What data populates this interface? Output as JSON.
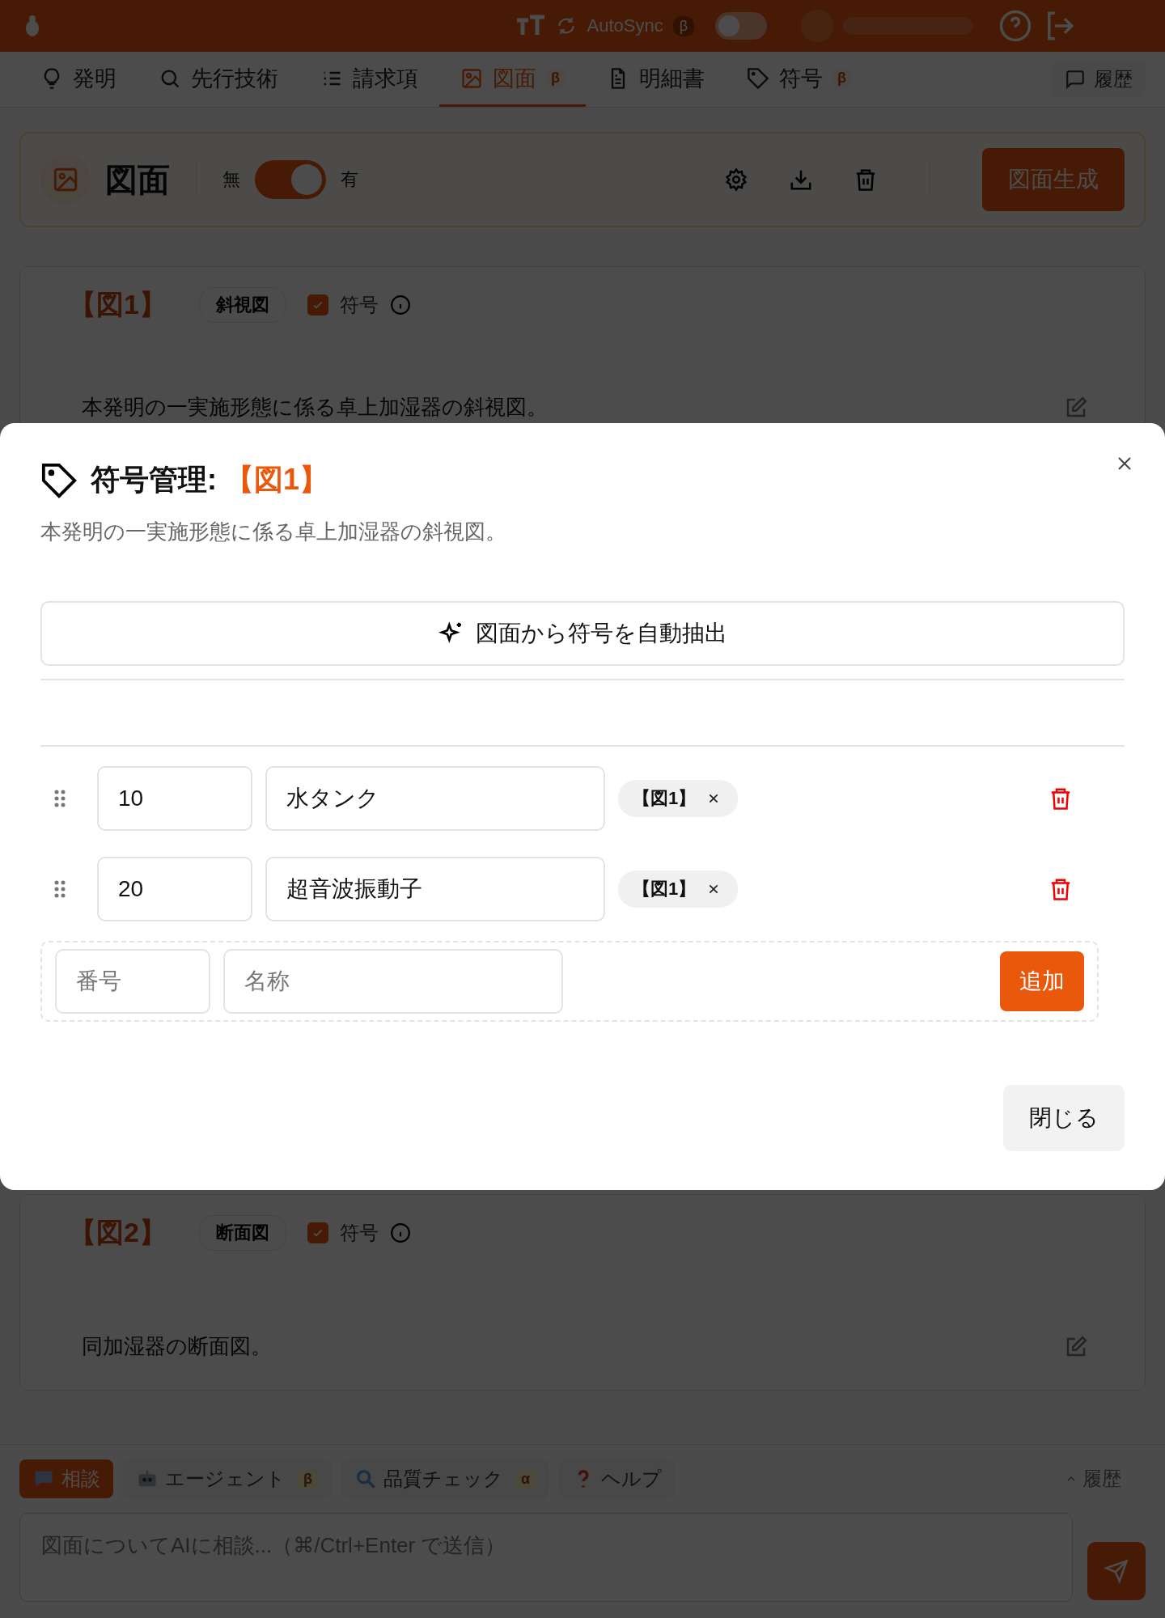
{
  "topbar": {
    "autosync": {
      "label": "AutoSync",
      "badge": "β",
      "on": false
    }
  },
  "tabs": [
    {
      "label": "発明",
      "selected": false
    },
    {
      "label": "先行技術",
      "selected": false
    },
    {
      "label": "請求項",
      "selected": false
    },
    {
      "label": "図面",
      "badge": "β",
      "selected": true
    },
    {
      "label": "明細書",
      "selected": false
    },
    {
      "label": "符号",
      "badge": "β",
      "selected": false
    }
  ],
  "history_button": "履歴",
  "header": {
    "title": "図面",
    "toggle_off_label": "無",
    "toggle_on_label": "有",
    "toggle_on": true,
    "generate_button": "図面生成"
  },
  "figures": [
    {
      "label": "【図1】",
      "view": "斜視図",
      "symbol_label": "符号",
      "symbol_checked": true,
      "description": "本発明の一実施形態に係る卓上加湿器の斜視図。"
    },
    {
      "label": "【図2】",
      "view": "断面図",
      "symbol_label": "符号",
      "symbol_checked": true,
      "description": "同加湿器の断面図。"
    }
  ],
  "modal": {
    "title": "符号管理:",
    "figure_ref": "【図1】",
    "description": "本発明の一実施形態に係る卓上加湿器の斜視図。",
    "auto_extract_button": "図面から符号を自動抽出",
    "rows": [
      {
        "number": "10",
        "name": "水タンク",
        "tags": [
          "【図1】"
        ]
      },
      {
        "number": "20",
        "name": "超音波振動子",
        "tags": [
          "【図1】"
        ]
      }
    ],
    "new_row": {
      "number_placeholder": "番号",
      "name_placeholder": "名称",
      "add_button": "追加"
    },
    "close_button": "閉じる"
  },
  "chat": {
    "tabs": [
      {
        "label": "相談",
        "selected": true
      },
      {
        "label": "エージェント",
        "badge": "β",
        "selected": false
      },
      {
        "label": "品質チェック",
        "badge": "α",
        "selected": false
      },
      {
        "label": "ヘルプ",
        "selected": false
      }
    ],
    "history_button": "履歴",
    "placeholder": "図面についてAIに相談...（⌘/Ctrl+Enter で送信）"
  }
}
